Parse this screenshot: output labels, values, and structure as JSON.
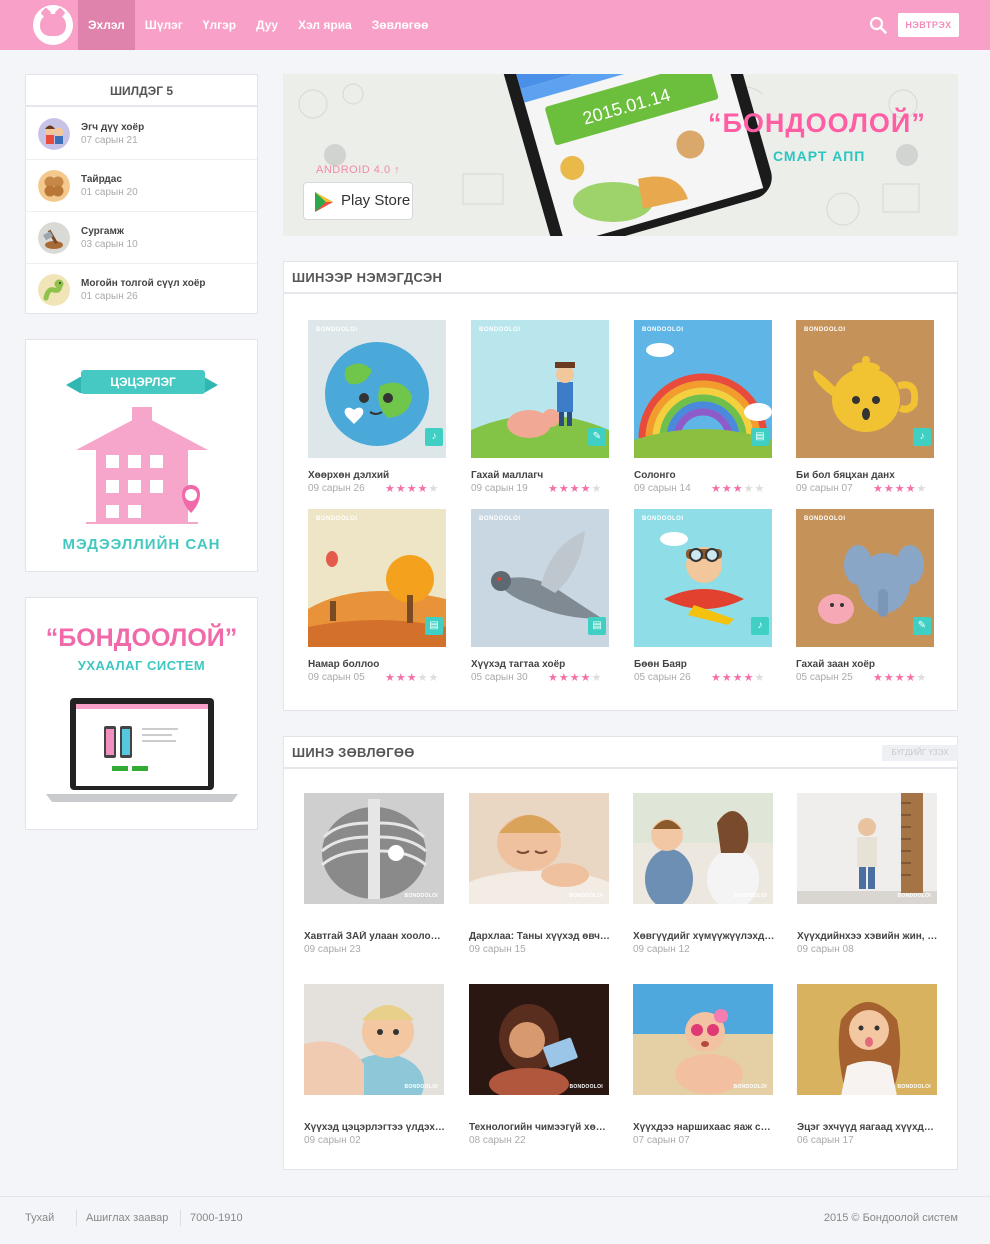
{
  "header": {
    "nav": [
      "Эхлэл",
      "Шүлэг",
      "Үлгэр",
      "Дуу",
      "Хэл яриа",
      "Зөвлөгөө"
    ],
    "login_label": "НЭВТРЭХ",
    "brand_color": "#f9a0c8",
    "icons": {
      "logo": "pink-cat-logo",
      "search": "search-icon"
    }
  },
  "sidebar": {
    "rank_title": "ШИЛДЭГ 5",
    "rank_items": [
      {
        "name": "Эгч дүү хоёр",
        "date": "07 сарын 21"
      },
      {
        "name": "Тайрдас",
        "date": "01 сарын 20"
      },
      {
        "name": "Сургамж",
        "date": "03 сарын 10"
      },
      {
        "name": "Могойн толгой сүүл хоёр",
        "date": "01 сарын 26"
      }
    ],
    "library_banner": {
      "ribbon": "ЦЭЦЭРЛЭГ",
      "title": "МЭДЭЭЛЛИЙН САН"
    },
    "system_banner": {
      "title": "“БОНДООЛОЙ”",
      "subtitle": "УХААЛАГ СИСТЕМ"
    }
  },
  "hero": {
    "android": "ANDROID 4.0 ↑",
    "store": "Play Store",
    "title": "“БОНДООЛОЙ”",
    "subtitle": "СМАРТ АПП"
  },
  "new_section": {
    "title": "ШИНЭЭР НЭМЭГДСЭН",
    "brand": "BONDOOLOI",
    "items": [
      {
        "title": "Хөөрхөн дэлхий",
        "date": "09 сарын 26",
        "rating": 4
      },
      {
        "title": "Гахай маллагч",
        "date": "09 сарын 19",
        "rating": 4
      },
      {
        "title": "Солонго",
        "date": "09 сарын 14",
        "rating": 3
      },
      {
        "title": "Би бол бяцхан данх",
        "date": "09 сарын 07",
        "rating": 4
      },
      {
        "title": "Намар боллоо",
        "date": "09 сарын 05",
        "rating": 3
      },
      {
        "title": "Хүүхэд тагтаа хоёр",
        "date": "05 сарын 30",
        "rating": 4
      },
      {
        "title": "Бөөн Баяр",
        "date": "05 сарын 26",
        "rating": 4
      },
      {
        "title": "Гахай заан хоёр",
        "date": "05 сарын 25",
        "rating": 4
      }
    ]
  },
  "tips_section": {
    "title": "ШИНЭ ЗӨВЛӨГӨӨ",
    "see_all": "БҮГДИЙГ ҮЗЭХ",
    "brand": "BONDOOLOI",
    "items": [
      {
        "title": "Хавтгай ЗАЙ улаан хоолойг ту...",
        "date": "09 сарын 23"
      },
      {
        "title": "Дархлаа: Таны хүүхэд өвчлөм...",
        "date": "09 сарын 15"
      },
      {
        "title": "Хөвгүүдийг хүмүүжүүлэхдээ а...",
        "date": "09 сарын 12"
      },
      {
        "title": "Хүүхдийнхээ хэвийн жин, өн...",
        "date": "09 сарын 08"
      },
      {
        "title": "Хүүхэд цэцэрлэгтээ үлдэхгүй ...",
        "date": "09 сарын 02"
      },
      {
        "title": "Технологийн чимээгүй хөнөөл",
        "date": "08 сарын 22"
      },
      {
        "title": "Хүүхдээ наршихаас яаж сэрги...",
        "date": "07 сарын 07"
      },
      {
        "title": "Эцэг эхчүүд яагаад хүүхдээ эрх...",
        "date": "06 сарын 17"
      }
    ]
  },
  "footer": {
    "links": [
      "Тухай",
      "Ашиглах заавар",
      "7000-1910"
    ],
    "copyright": "2015 © Бондоолой систем"
  },
  "colors": {
    "pink": "#f9a0c8",
    "accent_pink": "#f470a8",
    "teal": "#3fd0c3"
  }
}
